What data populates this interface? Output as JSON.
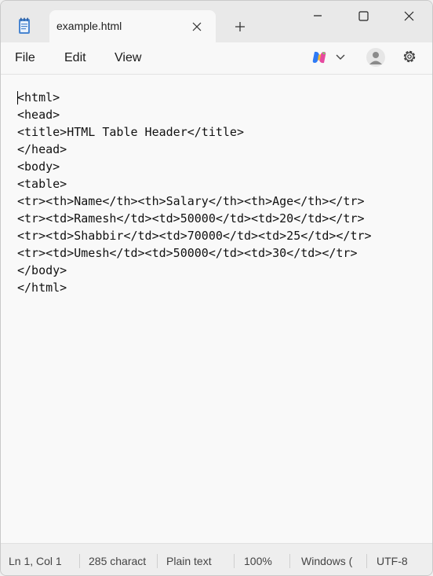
{
  "tab": {
    "title": "example.html",
    "icon": "notepad-icon",
    "close_icon": "close-icon",
    "new_tab_icon": "plus-icon"
  },
  "window_controls": [
    "minimize-icon",
    "maximize-icon",
    "close-icon"
  ],
  "menu": {
    "items": [
      "File",
      "Edit",
      "View"
    ],
    "copilot_icon": "copilot-icon",
    "account_icon": "account-icon",
    "settings_icon": "gear-icon"
  },
  "editor": {
    "lines": [
      "<html>",
      "<head>",
      "<title>HTML Table Header</title>",
      "</head>",
      "<body>",
      "<table>",
      "<tr><th>Name</th><th>Salary</th><th>Age</th></tr>",
      "<tr><td>Ramesh</td><td>50000</td><td>20</td></tr>",
      "<tr><td>Shabbir</td><td>70000</td><td>25</td></tr>",
      "<tr><td>Umesh</td><td>50000</td><td>30</td></tr>",
      "</body>",
      "</html>"
    ]
  },
  "status": {
    "position": "Ln 1, Col 1",
    "characters": "285 charact",
    "format": "Plain text",
    "zoom": "100%",
    "line_ending": "Windows (",
    "encoding": "UTF-8"
  },
  "colors": {
    "copilot_blue": "#2f7bf5",
    "copilot_pink": "#e64aa0",
    "copilot_yellow": "#f5b82e",
    "notepad_blue": "#3b78c4"
  }
}
